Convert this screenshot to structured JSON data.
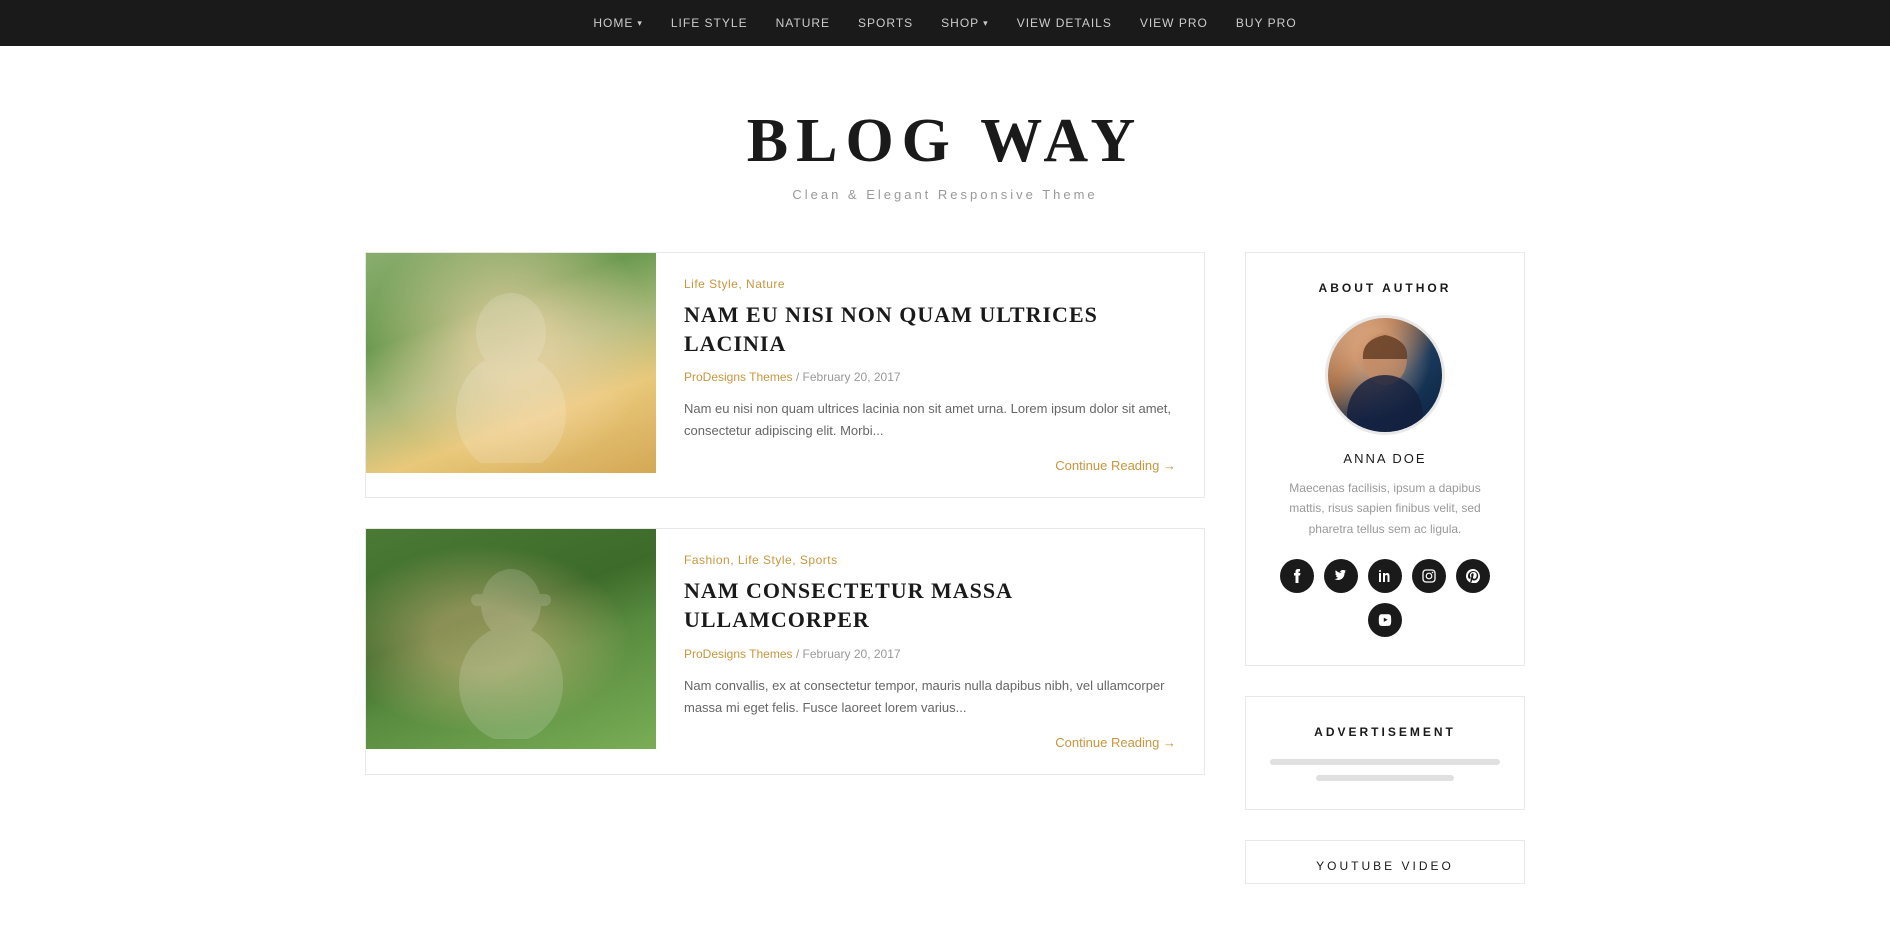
{
  "nav": {
    "items": [
      {
        "label": "HOME",
        "has_dropdown": true
      },
      {
        "label": "LIFE STYLE",
        "has_dropdown": false
      },
      {
        "label": "NATURE",
        "has_dropdown": false
      },
      {
        "label": "SPORTS",
        "has_dropdown": false
      },
      {
        "label": "SHOP",
        "has_dropdown": true
      },
      {
        "label": "VIEW DETAILS",
        "has_dropdown": false
      },
      {
        "label": "VIEW PRO",
        "has_dropdown": false
      },
      {
        "label": "BUY PRO",
        "has_dropdown": false
      }
    ]
  },
  "header": {
    "title": "BLOG WAY",
    "tagline": "Clean & Elegant Responsive Theme"
  },
  "posts": [
    {
      "id": 1,
      "categories": "Life Style, Nature",
      "title": "NAM EU NISI NON QUAM ULTRICES LACINIA",
      "author": "ProDesigns Themes",
      "date": "February 20, 2017",
      "excerpt": "Nam eu nisi non quam ultrices lacinia non sit amet urna. Lorem ipsum dolor sit amet, consectetur adipiscing elit. Morbi...",
      "continue_reading": "Continue Reading →"
    },
    {
      "id": 2,
      "categories": "Fashion, Life Style, Sports",
      "title": "NAM CONSECTETUR MASSA ULLAMCORPER",
      "author": "ProDesigns Themes",
      "date": "February 20, 2017",
      "excerpt": "Nam convallis, ex at consectetur tempor, mauris nulla dapibus nibh, vel ullamcorper massa mi eget felis. Fusce laoreet lorem varius...",
      "continue_reading": "Continue Reading →"
    }
  ],
  "sidebar": {
    "about_widget": {
      "title": "ABOUT AUTHOR",
      "author_name": "ANNA DOE",
      "author_bio": "Maecenas facilisis, ipsum a dapibus mattis, risus sapien finibus velit, sed pharetra tellus sem ac ligula.",
      "social_icons": [
        "f",
        "t",
        "in",
        "ig",
        "p",
        "yt"
      ]
    },
    "ad_widget": {
      "title": "ADVERTISEMENT"
    },
    "youtube_widget": {
      "title": "YOUTUBE VIDEO"
    }
  }
}
